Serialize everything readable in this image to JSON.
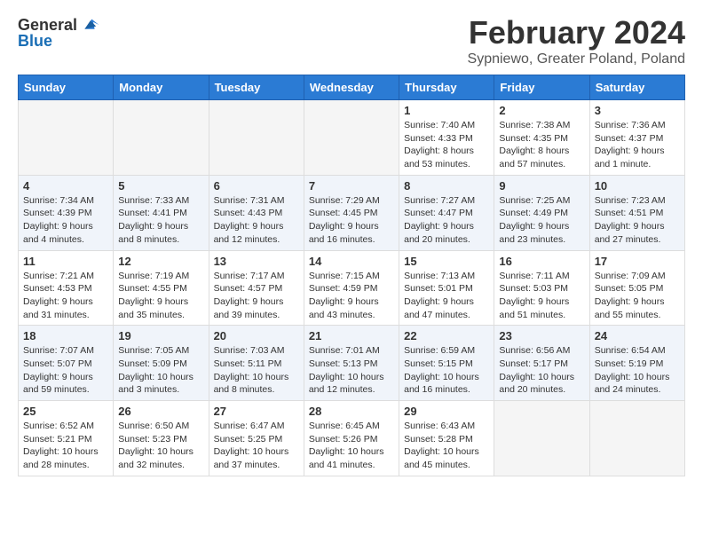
{
  "header": {
    "logo_general": "General",
    "logo_blue": "Blue",
    "title": "February 2024",
    "subtitle": "Sypniewo, Greater Poland, Poland"
  },
  "calendar": {
    "weekdays": [
      "Sunday",
      "Monday",
      "Tuesday",
      "Wednesday",
      "Thursday",
      "Friday",
      "Saturday"
    ],
    "weeks": [
      {
        "days": [
          {
            "num": "",
            "info": ""
          },
          {
            "num": "",
            "info": ""
          },
          {
            "num": "",
            "info": ""
          },
          {
            "num": "",
            "info": ""
          },
          {
            "num": "1",
            "info": "Sunrise: 7:40 AM\nSunset: 4:33 PM\nDaylight: 8 hours\nand 53 minutes."
          },
          {
            "num": "2",
            "info": "Sunrise: 7:38 AM\nSunset: 4:35 PM\nDaylight: 8 hours\nand 57 minutes."
          },
          {
            "num": "3",
            "info": "Sunrise: 7:36 AM\nSunset: 4:37 PM\nDaylight: 9 hours\nand 1 minute."
          }
        ]
      },
      {
        "days": [
          {
            "num": "4",
            "info": "Sunrise: 7:34 AM\nSunset: 4:39 PM\nDaylight: 9 hours\nand 4 minutes."
          },
          {
            "num": "5",
            "info": "Sunrise: 7:33 AM\nSunset: 4:41 PM\nDaylight: 9 hours\nand 8 minutes."
          },
          {
            "num": "6",
            "info": "Sunrise: 7:31 AM\nSunset: 4:43 PM\nDaylight: 9 hours\nand 12 minutes."
          },
          {
            "num": "7",
            "info": "Sunrise: 7:29 AM\nSunset: 4:45 PM\nDaylight: 9 hours\nand 16 minutes."
          },
          {
            "num": "8",
            "info": "Sunrise: 7:27 AM\nSunset: 4:47 PM\nDaylight: 9 hours\nand 20 minutes."
          },
          {
            "num": "9",
            "info": "Sunrise: 7:25 AM\nSunset: 4:49 PM\nDaylight: 9 hours\nand 23 minutes."
          },
          {
            "num": "10",
            "info": "Sunrise: 7:23 AM\nSunset: 4:51 PM\nDaylight: 9 hours\nand 27 minutes."
          }
        ]
      },
      {
        "days": [
          {
            "num": "11",
            "info": "Sunrise: 7:21 AM\nSunset: 4:53 PM\nDaylight: 9 hours\nand 31 minutes."
          },
          {
            "num": "12",
            "info": "Sunrise: 7:19 AM\nSunset: 4:55 PM\nDaylight: 9 hours\nand 35 minutes."
          },
          {
            "num": "13",
            "info": "Sunrise: 7:17 AM\nSunset: 4:57 PM\nDaylight: 9 hours\nand 39 minutes."
          },
          {
            "num": "14",
            "info": "Sunrise: 7:15 AM\nSunset: 4:59 PM\nDaylight: 9 hours\nand 43 minutes."
          },
          {
            "num": "15",
            "info": "Sunrise: 7:13 AM\nSunset: 5:01 PM\nDaylight: 9 hours\nand 47 minutes."
          },
          {
            "num": "16",
            "info": "Sunrise: 7:11 AM\nSunset: 5:03 PM\nDaylight: 9 hours\nand 51 minutes."
          },
          {
            "num": "17",
            "info": "Sunrise: 7:09 AM\nSunset: 5:05 PM\nDaylight: 9 hours\nand 55 minutes."
          }
        ]
      },
      {
        "days": [
          {
            "num": "18",
            "info": "Sunrise: 7:07 AM\nSunset: 5:07 PM\nDaylight: 9 hours\nand 59 minutes."
          },
          {
            "num": "19",
            "info": "Sunrise: 7:05 AM\nSunset: 5:09 PM\nDaylight: 10 hours\nand 3 minutes."
          },
          {
            "num": "20",
            "info": "Sunrise: 7:03 AM\nSunset: 5:11 PM\nDaylight: 10 hours\nand 8 minutes."
          },
          {
            "num": "21",
            "info": "Sunrise: 7:01 AM\nSunset: 5:13 PM\nDaylight: 10 hours\nand 12 minutes."
          },
          {
            "num": "22",
            "info": "Sunrise: 6:59 AM\nSunset: 5:15 PM\nDaylight: 10 hours\nand 16 minutes."
          },
          {
            "num": "23",
            "info": "Sunrise: 6:56 AM\nSunset: 5:17 PM\nDaylight: 10 hours\nand 20 minutes."
          },
          {
            "num": "24",
            "info": "Sunrise: 6:54 AM\nSunset: 5:19 PM\nDaylight: 10 hours\nand 24 minutes."
          }
        ]
      },
      {
        "days": [
          {
            "num": "25",
            "info": "Sunrise: 6:52 AM\nSunset: 5:21 PM\nDaylight: 10 hours\nand 28 minutes."
          },
          {
            "num": "26",
            "info": "Sunrise: 6:50 AM\nSunset: 5:23 PM\nDaylight: 10 hours\nand 32 minutes."
          },
          {
            "num": "27",
            "info": "Sunrise: 6:47 AM\nSunset: 5:25 PM\nDaylight: 10 hours\nand 37 minutes."
          },
          {
            "num": "28",
            "info": "Sunrise: 6:45 AM\nSunset: 5:26 PM\nDaylight: 10 hours\nand 41 minutes."
          },
          {
            "num": "29",
            "info": "Sunrise: 6:43 AM\nSunset: 5:28 PM\nDaylight: 10 hours\nand 45 minutes."
          },
          {
            "num": "",
            "info": ""
          },
          {
            "num": "",
            "info": ""
          }
        ]
      }
    ]
  }
}
